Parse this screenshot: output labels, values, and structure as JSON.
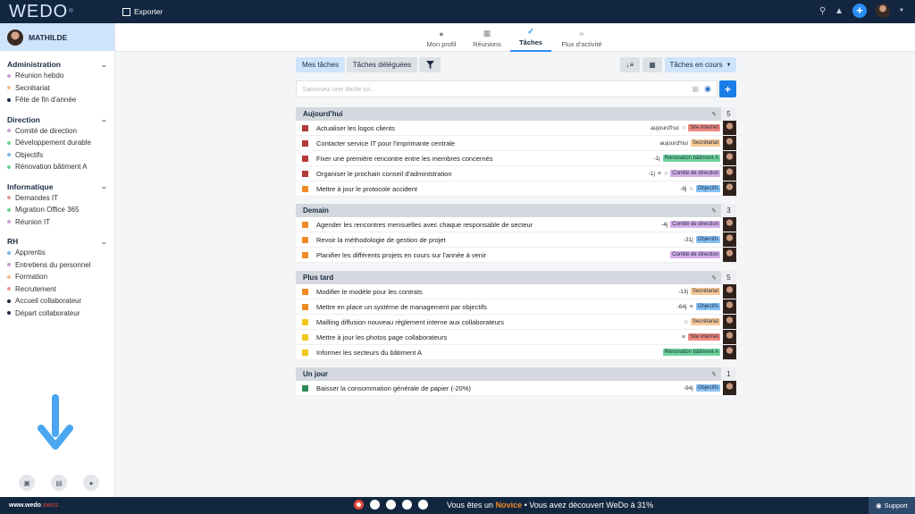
{
  "brand": {
    "logo": "WEDO",
    "site_prefix": "www.wedo",
    "site_suffix": ".swiss"
  },
  "topbar": {
    "export_label": "Exporter"
  },
  "user": {
    "name": "MATHILDE"
  },
  "sidebar": {
    "groups": [
      {
        "title": "Administration",
        "items": [
          {
            "label": "Réunion hebdo",
            "color": "#c9a0dc"
          },
          {
            "label": "Secrétariat",
            "color": "#f5c28a"
          },
          {
            "label": "Fête de fin d'année",
            "color": "#1b2b40"
          }
        ]
      },
      {
        "title": "Direction",
        "items": [
          {
            "label": "Comité de direction",
            "color": "#c9a0dc"
          },
          {
            "label": "Développement durable",
            "color": "#6fcf97"
          },
          {
            "label": "Objectifs",
            "color": "#7db7f0"
          },
          {
            "label": "Rénovation bâtiment A",
            "color": "#6fcf97"
          }
        ]
      },
      {
        "title": "Informatique",
        "items": [
          {
            "label": "Demandes IT",
            "color": "#e89a9a"
          },
          {
            "label": "Migration Office 365",
            "color": "#6fcf97"
          },
          {
            "label": "Réunion IT",
            "color": "#c9a0dc"
          }
        ]
      },
      {
        "title": "RH",
        "items": [
          {
            "label": "Apprentis",
            "color": "#7db7f0"
          },
          {
            "label": "Entretiens du personnel",
            "color": "#c9a0dc"
          },
          {
            "label": "Formation",
            "color": "#f5c28a"
          },
          {
            "label": "Recrutement",
            "color": "#e89a9a"
          },
          {
            "label": "Accueil collaborateur",
            "color": "#1b2b40"
          },
          {
            "label": "Départ collaborateur",
            "color": "#1b2b40"
          }
        ]
      }
    ]
  },
  "nav": {
    "tabs": [
      {
        "label": "Mon profil",
        "icon": "user-icon"
      },
      {
        "label": "Réunions",
        "icon": "calendar-icon"
      },
      {
        "label": "Tâches",
        "icon": "check-icon",
        "active": true
      },
      {
        "label": "Flux d'activité",
        "icon": "rss-icon"
      }
    ]
  },
  "toolbar": {
    "my_tasks": "Mes tâches",
    "delegated": "Tâches déléguées",
    "status": "Tâches en cours"
  },
  "search": {
    "placeholder": "Saisissez une tâche ici..."
  },
  "tags": {
    "Site internet": "#f08a7e",
    "Secrétariat": "#f9c998",
    "Rénovation bâtiment A": "#6fd49b",
    "Comité de direction": "#d5aee8",
    "Objectifs": "#86c1f5"
  },
  "sections": [
    {
      "title": "Aujourd'hui",
      "count": "5",
      "tasks": [
        {
          "title": "Actualiser les logos clients",
          "color": "#b33a3a",
          "date": "aujourd'hui",
          "icons": [
            "comment"
          ],
          "tag": "Site internet"
        },
        {
          "title": "Contacter service IT pour l'imprimante centrale",
          "color": "#b33a3a",
          "date": "aujourd'hui",
          "icons": [],
          "tag": "Secrétariat"
        },
        {
          "title": "Fixer une première rencontre entre les membres concernés",
          "color": "#b33a3a",
          "date": "-1j",
          "icons": [],
          "tag": "Rénovation bâtiment A"
        },
        {
          "title": "Organiser le prochain conseil d'administration",
          "color": "#b33a3a",
          "date": "-1j",
          "icons": [
            "list",
            "comment"
          ],
          "tag": "Comité de direction"
        },
        {
          "title": "Mettre à jour le protocole accident",
          "color": "#f08a24",
          "date": "-8j",
          "icons": [
            "comment"
          ],
          "tag": "Objectifs"
        }
      ]
    },
    {
      "title": "Demain",
      "count": "3",
      "tasks": [
        {
          "title": "Agender les rencontres mensuelles avec chaque responsable de secteur",
          "color": "#f08a24",
          "date": "-4j",
          "icons": [],
          "tag": "Comité de direction"
        },
        {
          "title": "Revoir la méthodologie de gestion de projet",
          "color": "#f08a24",
          "date": "-31j",
          "icons": [],
          "tag": "Objectifs"
        },
        {
          "title": "Planifier les différents projets en cours sur l'année à venir",
          "color": "#f08a24",
          "date": "",
          "icons": [],
          "tag": "Comité de direction"
        }
      ]
    },
    {
      "title": "Plus tard",
      "count": "5",
      "tasks": [
        {
          "title": "Modifier le modèle pour les contrats",
          "color": "#f08a24",
          "date": "-13j",
          "icons": [],
          "tag": "Secrétariat"
        },
        {
          "title": "Mettre en place un système de management par objectifs",
          "color": "#f08a24",
          "date": "-64j",
          "icons": [
            "list"
          ],
          "tag": "Objectifs"
        },
        {
          "title": "Mailling diffusion nouveau règlement interne aux collaborateurs",
          "color": "#f2c81e",
          "date": "",
          "icons": [
            "comment"
          ],
          "tag": "Secrétariat"
        },
        {
          "title": "Mettre à jour les photos page collaborateurs",
          "color": "#f2c81e",
          "date": "",
          "icons": [
            "list"
          ],
          "tag": "Site internet"
        },
        {
          "title": "Informer les secteurs du bâtiment A",
          "color": "#f2c81e",
          "date": "",
          "icons": [],
          "tag": "Rénovation bâtiment A"
        }
      ]
    },
    {
      "title": "Un jour",
      "count": "1",
      "tasks": [
        {
          "title": "Baisser la consommation générale de papier (-20%)",
          "color": "#2e8b57",
          "date": "-94j",
          "icons": [],
          "tag": "Objectifs"
        }
      ]
    }
  ],
  "footer": {
    "msg_before": "Vous êtes un",
    "level": "Novice",
    "msg_after": "• Vous avez découvert WeDo à 31%",
    "support": "Support"
  }
}
